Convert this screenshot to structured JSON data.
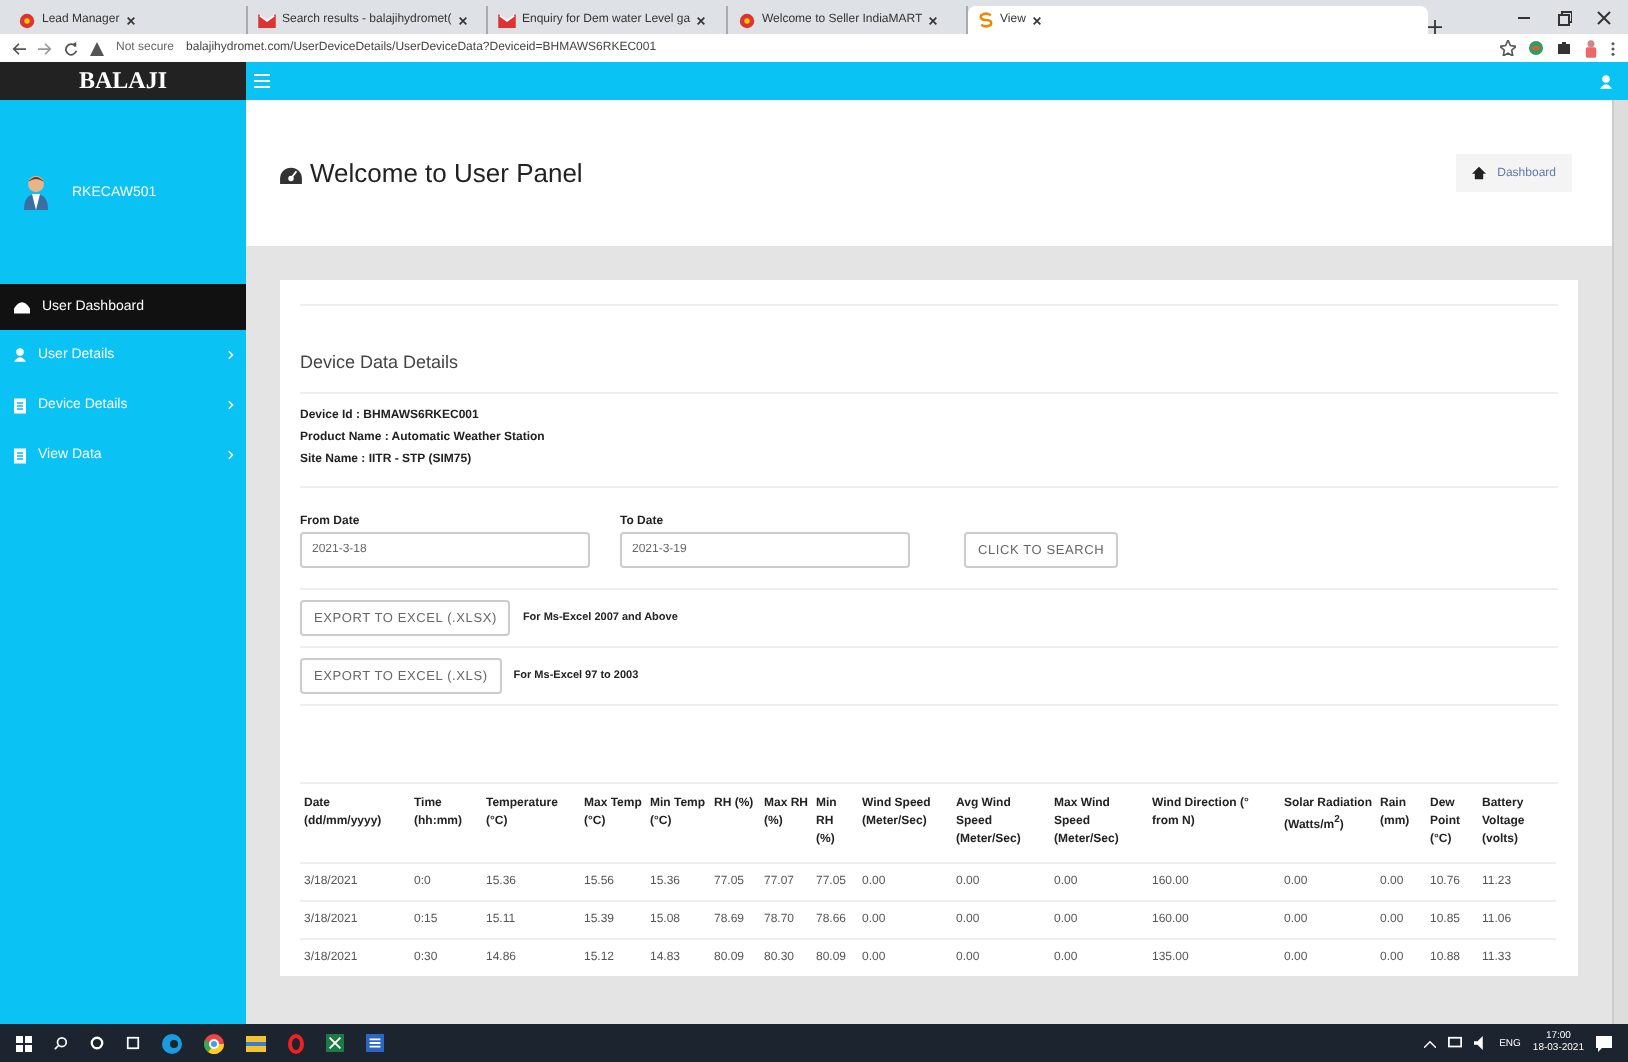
{
  "browser": {
    "tabs": [
      {
        "title": "Lead Manager",
        "kind": "indiamart",
        "selected": false
      },
      {
        "title": "Search results - balajihydromet(",
        "kind": "gmail",
        "selected": false
      },
      {
        "title": "Enquiry for Dem water Level ga",
        "kind": "gmail",
        "selected": false
      },
      {
        "title": "Welcome to Seller IndiaMART",
        "kind": "indiamart",
        "selected": false
      },
      {
        "title": "View",
        "kind": "site",
        "selected": true
      }
    ],
    "address": {
      "security": "Not secure",
      "url": "balajihydromet.com/UserDeviceDetails/UserDeviceData?Deviceid=BHMAWS6RKEC001"
    }
  },
  "app": {
    "brand": "BALAJI",
    "user": "RKECAW501",
    "menu": [
      {
        "label": "User Dashboard",
        "kind": "home",
        "selected": true,
        "arrow": false
      },
      {
        "label": "User Details",
        "kind": "user",
        "selected": false,
        "arrow": true
      },
      {
        "label": "Device Details",
        "kind": "doc",
        "selected": false,
        "arrow": true
      },
      {
        "label": "View Data",
        "kind": "doc",
        "selected": false,
        "arrow": true
      }
    ],
    "page_title": "Welcome to User Panel",
    "breadcrumb": "Dashboard",
    "card": {
      "heading": "Device Data Details",
      "info": [
        "Device Id : BHMAWS6RKEC001",
        "Product Name : Automatic Weather Station",
        "Site Name : IITR - STP (SIM75)"
      ],
      "from": {
        "label": "From Date",
        "value": "2021-3-18"
      },
      "to": {
        "label": "To Date",
        "value": "2021-3-19"
      },
      "search_button": "CLICK TO SEARCH",
      "exports": [
        {
          "button": "EXPORT TO EXCEL (.XLSX)",
          "note": "For Ms-Excel 2007 and Above"
        },
        {
          "button": "EXPORT TO EXCEL (.XLS)",
          "note": "For Ms-Excel 97 to 2003"
        }
      ],
      "table": {
        "columns": [
          "Date (dd/mm/yyyy)",
          "Time (hh:mm)",
          "Temperature (°C)",
          "Max Temp (°C)",
          "Min Temp (°C)",
          "RH (%)",
          "Max RH (%)",
          "Min RH (%)",
          "Wind Speed (Meter/Sec)",
          "Avg Wind Speed (Meter/Sec)",
          "Max Wind Speed (Meter/Sec)",
          "Wind Direction (° from N)",
          "Solar Radiation (Watts/m$^{2}$)",
          "Rain (mm)",
          "Dew Point (°C)",
          "Battery Voltage (volts)"
        ],
        "rows": [
          [
            "3/18/2021",
            "0:0",
            "15.36",
            "15.56",
            "15.36",
            "77.05",
            "77.07",
            "77.05",
            "0.00",
            "0.00",
            "0.00",
            "160.00",
            "0.00",
            "0.00",
            "10.76",
            "11.23"
          ],
          [
            "3/18/2021",
            "0:15",
            "15.11",
            "15.39",
            "15.08",
            "78.69",
            "78.70",
            "78.66",
            "0.00",
            "0.00",
            "0.00",
            "160.00",
            "0.00",
            "0.00",
            "10.85",
            "11.06"
          ],
          [
            "3/18/2021",
            "0:30",
            "14.86",
            "15.12",
            "14.83",
            "80.09",
            "80.30",
            "80.09",
            "0.00",
            "0.00",
            "0.00",
            "135.00",
            "0.00",
            "0.00",
            "10.88",
            "11.33"
          ]
        ]
      }
    }
  },
  "taskbar": {
    "language": "ENG",
    "time": "17:00",
    "date": "18-03-2021"
  }
}
